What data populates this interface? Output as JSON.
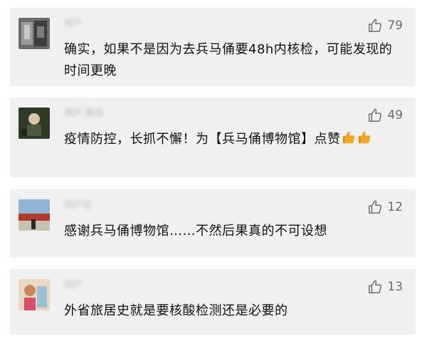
{
  "comments": [
    {
      "author": "用户",
      "likes": "79",
      "text": "确实，如果不是因为去兵马俑要48h内核检，可能发现的时间更晚"
    },
    {
      "author": "用户 紫云",
      "likes": "49",
      "text": "疫情防控，长抓不懈！为【兵马俑博物馆】点赞",
      "emoji": [
        "thumbs-up-emoji",
        "thumbs-up-emoji"
      ]
    },
    {
      "author": "用户名",
      "likes": "12",
      "text": "感谢兵马俑博物馆……不然后果真的不可设想"
    },
    {
      "author": "用户",
      "likes": "13",
      "text": "外省旅居史就是要核酸检测还是必要的"
    }
  ],
  "icons": {
    "like": "thumbs-up-outline-icon",
    "like_color": "#6b6b6b",
    "emoji_color": "#f5a623"
  }
}
